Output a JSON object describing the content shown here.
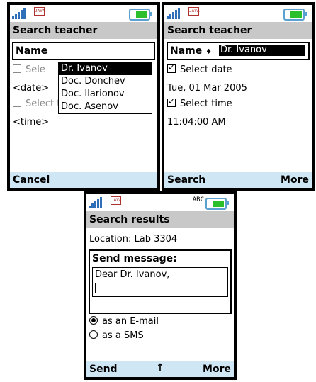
{
  "screens": [
    {
      "title": "Search teacher",
      "name_label": "Name",
      "name_selected": "Dr. Ivanov",
      "dropdown_options": [
        "Dr. Ivanov",
        "Doc. Donchev",
        "Doc. Ilarionov",
        "Doc. Asenov"
      ],
      "select_date_label": "Sele",
      "date_placeholder": "<date>",
      "select_time_label": "Select time",
      "time_placeholder": "<time>",
      "left_soft": "Cancel",
      "right_soft": ""
    },
    {
      "title": "Search teacher",
      "name_label": "Name",
      "name_arrow": "♦",
      "name_selected": "Dr. Ivanov",
      "select_date_label": "Select date",
      "date_value": "Tue, 01 Mar 2005",
      "select_time_label": "Select time",
      "time_value": "11:04:00 AM",
      "left_soft": "Search",
      "right_soft": "More"
    },
    {
      "title": "Search results",
      "location": "Location: Lab 3304",
      "send_message_label": "Send message:",
      "message_text": "Dear Dr. Ivanov,",
      "option_email": "as an E-mail",
      "option_sms": "as a SMS",
      "input_mode": "ABC",
      "left_soft": "Send",
      "center_soft": "↑",
      "right_soft": "More"
    }
  ],
  "status": {
    "java_badge": "JAVA"
  },
  "colors": {
    "softbar": "#cfe6f5",
    "titlebar": "#c8c8c8",
    "battery": "#2cbf2c",
    "signal": "#2f6fb8"
  }
}
